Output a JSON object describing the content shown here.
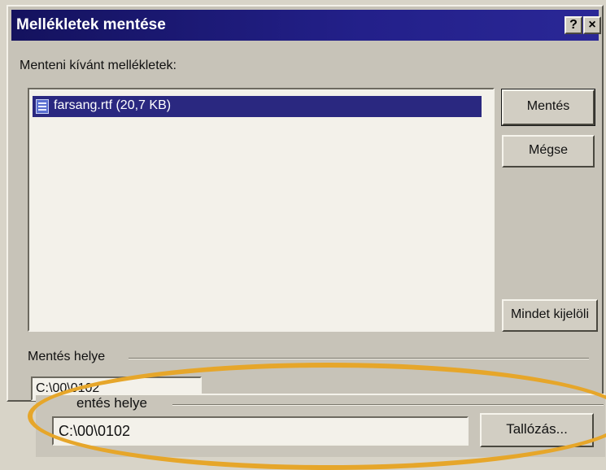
{
  "dialog": {
    "title": "Mellékletek mentése",
    "help_button": "?",
    "close_button": "×"
  },
  "attachments": {
    "label": "Menteni kívánt mellékletek:",
    "items": [
      {
        "label": "farsang.rtf (20,7 KB)",
        "selected": true
      }
    ]
  },
  "buttons": {
    "save": "Mentés",
    "cancel": "Mégse",
    "select_all": "Mindet kijelöli",
    "browse": "Tallózás..."
  },
  "save_location": {
    "label": "Mentés helye",
    "path": "C:\\00\\0102"
  },
  "zoomed_save_location": {
    "label": "entés helye",
    "path": "C:\\00\\0102"
  },
  "colors": {
    "titlebar": "#23208a",
    "selection": "#2a2880",
    "highlight_ellipse": "#e6a62a"
  }
}
